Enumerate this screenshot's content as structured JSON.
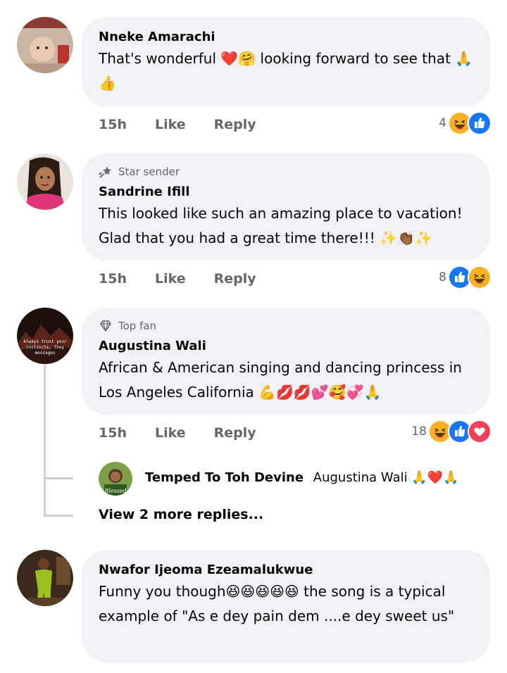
{
  "comments": [
    {
      "badge": "",
      "author": "Nneke Amarachi",
      "text": "That's wonderful ❤️🤗 looking forward to see that 🙏👍",
      "time": "15h",
      "like": "Like",
      "reply": "Reply",
      "reaction_count": "4",
      "reactions": [
        "haha",
        "like"
      ]
    },
    {
      "badge": "Star sender",
      "author": "Sandrine Ifill",
      "text": "This looked like such an amazing place to vacation! Glad that you had a great time there!!! ✨👏🏾✨",
      "time": "15h",
      "like": "Like",
      "reply": "Reply",
      "reaction_count": "8",
      "reactions": [
        "like",
        "haha"
      ]
    },
    {
      "badge": "Top fan",
      "author": "Augustina Wali",
      "text": "African & American singing and dancing princess in Los Angeles California 💪💋💋💕🥰💞🙏",
      "time": "15h",
      "like": "Like",
      "reply": "Reply",
      "reaction_count": "18",
      "reactions": [
        "haha",
        "like",
        "love"
      ],
      "reply_preview": {
        "author": "Temped To Toh Devine",
        "text": "Augustina Wali 🙏❤️🙏"
      },
      "more_replies": "View 2 more replies..."
    },
    {
      "badge": "",
      "author": "Nwafor Ijeoma Ezeamalukwue",
      "text": "Funny you though😆😆😆😆😆 the song is a typical example of \"As e dey pain dem ....e dey sweet us\"",
      "time": "",
      "like": "",
      "reply": ""
    }
  ],
  "colors": {
    "bubble": "#f0f2f5",
    "meta_text": "#65676b",
    "like_blue": "#1877f2",
    "love_red": "#f33e58",
    "haha_yellow": "#f7b125"
  },
  "avatar3_text": "Always trust your instincts, they messages"
}
